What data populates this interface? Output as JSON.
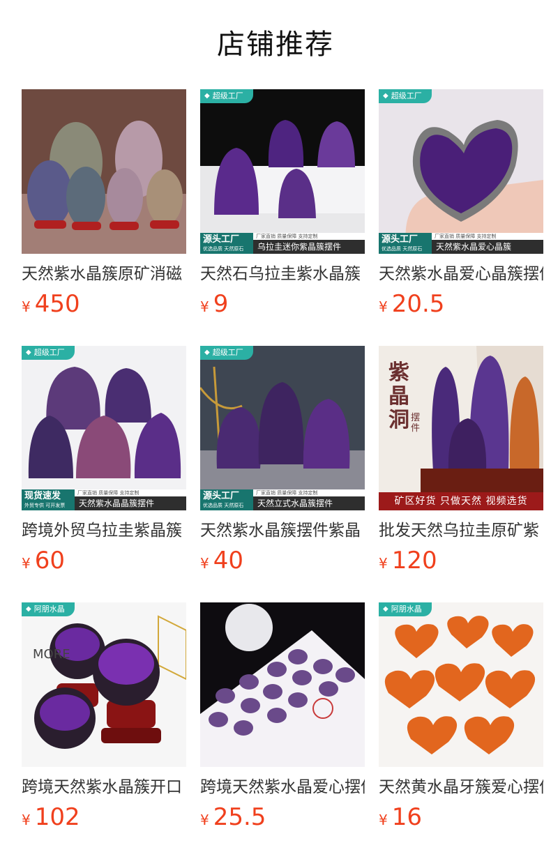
{
  "page_title": "店铺推荐",
  "currency": "¥",
  "products": [
    {
      "name": "天然紫水晶簇原矿消磁",
      "price": "450"
    },
    {
      "name": "天然石乌拉圭紫水晶簇",
      "price": "9",
      "badge": "超级工厂",
      "banner_main": "源头工厂",
      "banner_sub": "优选品质 天然原石",
      "banner_tags": "厂家直销  质量保障  支持定制",
      "banner_desc": "乌拉圭迷你紫晶簇摆件"
    },
    {
      "name": "天然紫水晶爱心晶簇摆件",
      "price": "20.5",
      "badge": "超级工厂",
      "banner_main": "源头工厂",
      "banner_sub": "优选品质 天然原石",
      "banner_tags": "厂家直销  质量保障  支持定制",
      "banner_desc": "天然紫水晶爱心晶簇"
    },
    {
      "name": "跨境外贸乌拉圭紫晶簇",
      "price": "60",
      "badge": "超级工厂",
      "banner_main": "现货速发",
      "banner_sub": "外贸专供 可开发票",
      "banner_tags": "厂家直销  质量保障  支持定制",
      "banner_desc": "天然紫水晶晶簇摆件"
    },
    {
      "name": "天然紫水晶簇摆件紫晶",
      "price": "40",
      "badge": "超级工厂",
      "banner_main": "源头工厂",
      "banner_sub": "优选品质 天然原石",
      "banner_tags": "厂家直销  质量保障  支持定制",
      "banner_desc": "天然立式水晶簇摆件"
    },
    {
      "name": "批发天然乌拉圭原矿紫",
      "price": "120",
      "vertical_title": "紫晶洞",
      "vertical_sub": "摆件",
      "red_bar": "矿区好货  只做天然  视频选货"
    },
    {
      "name": "跨境天然紫水晶簇开口",
      "price": "102",
      "badge": "阿朋水晶",
      "side_text": "MORE"
    },
    {
      "name": "跨境天然紫水晶爱心摆件",
      "price": "25.5"
    },
    {
      "name": "天然黄水晶牙簇爱心摆件",
      "price": "16",
      "badge": "阿朋水晶"
    }
  ],
  "colors": {
    "price": "#f0401d",
    "badge": "#2bb0a4",
    "banner": "#18756e",
    "red_bar": "#9c1a1a"
  },
  "icons": {
    "badge": "diamond-icon"
  }
}
